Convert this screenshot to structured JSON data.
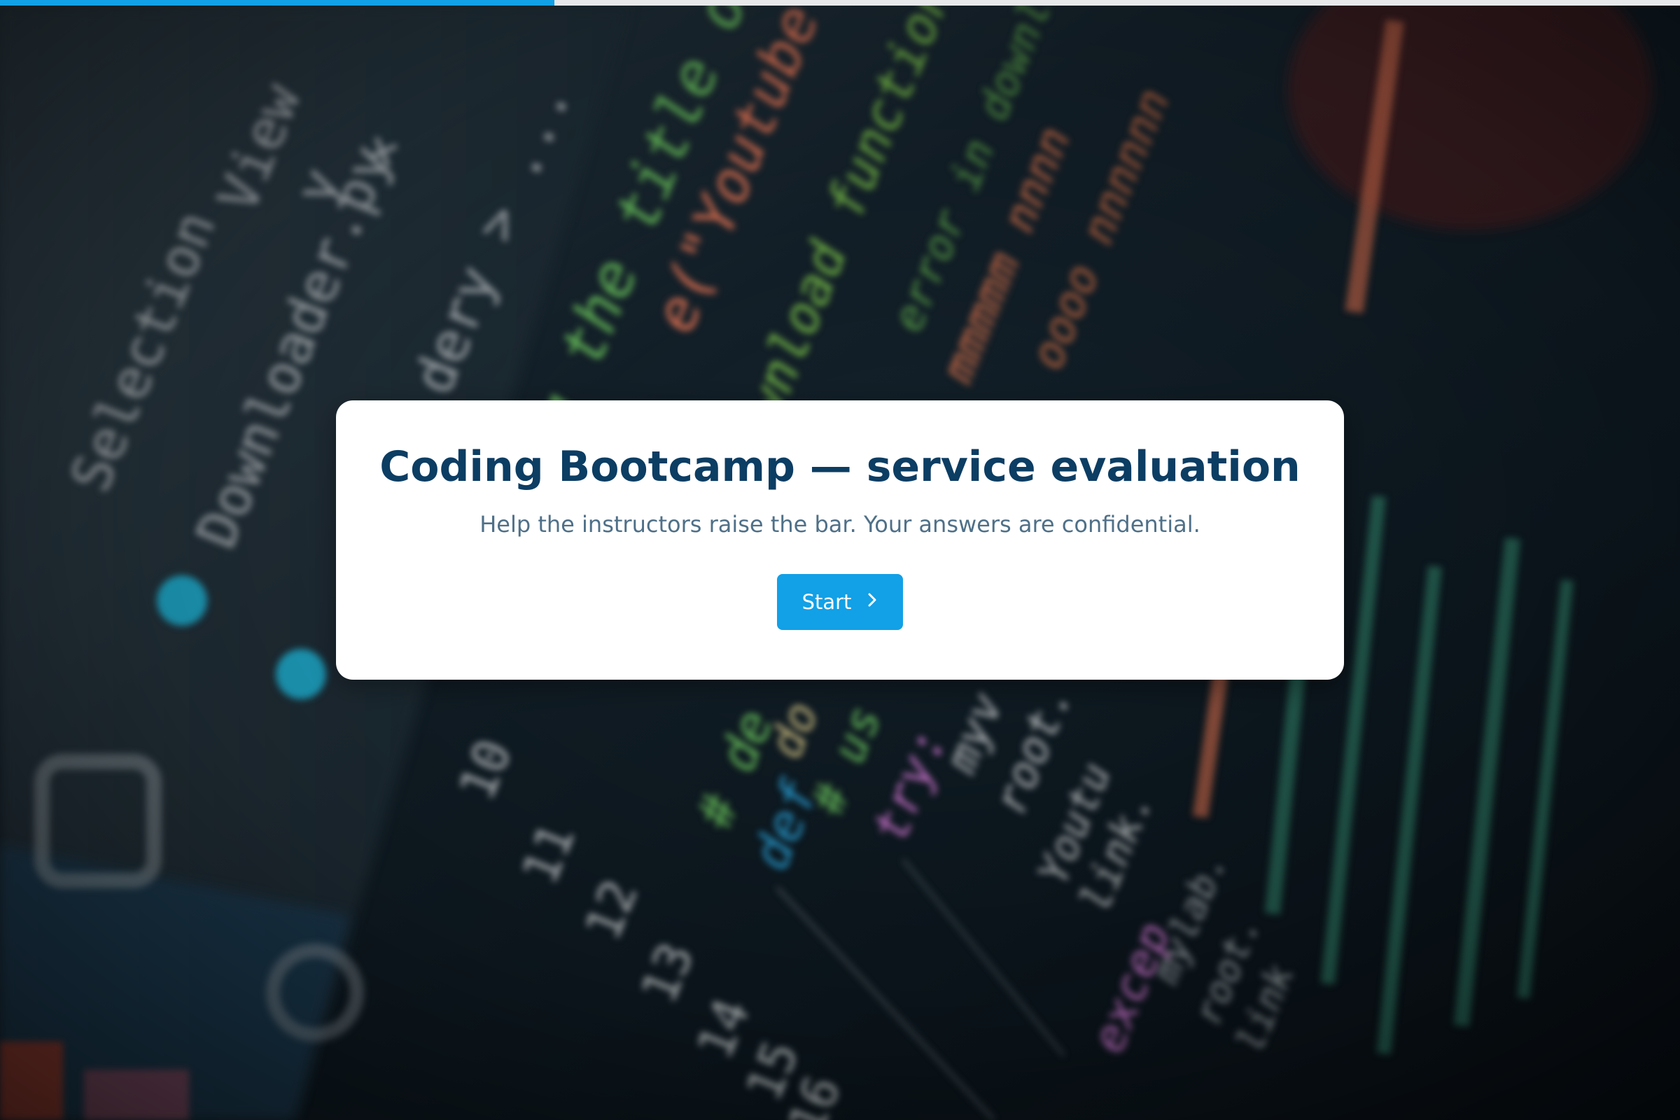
{
  "progress": {
    "fraction": 0.33
  },
  "card": {
    "title": "Coding Bootcamp — service evaluation",
    "subtitle": "Help the instructors raise the bar. Your answers are confidential.",
    "start_label": "Start",
    "start_icon": "chevron-right-icon"
  },
  "colors": {
    "accent": "#12a0e6",
    "title": "#0c3d63",
    "subtitle": "#4f7088",
    "progress_track": "#e6e8ea"
  }
}
